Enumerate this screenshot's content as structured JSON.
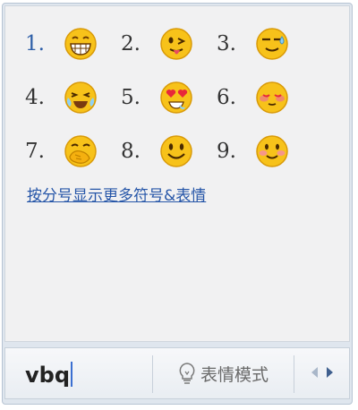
{
  "candidates": [
    {
      "num": "1.",
      "emoji": "grin",
      "selected": true
    },
    {
      "num": "2.",
      "emoji": "wink-tongue",
      "selected": false
    },
    {
      "num": "3.",
      "emoji": "sweat-smirk",
      "selected": false
    },
    {
      "num": "4.",
      "emoji": "crying-laugh",
      "selected": false
    },
    {
      "num": "5.",
      "emoji": "heart-eyes",
      "selected": false
    },
    {
      "num": "6.",
      "emoji": "blush-closed-eyes",
      "selected": false
    },
    {
      "num": "7.",
      "emoji": "hand-over-mouth",
      "selected": false
    },
    {
      "num": "8.",
      "emoji": "smile",
      "selected": false
    },
    {
      "num": "9.",
      "emoji": "blush-smile",
      "selected": false
    }
  ],
  "more_link": "按分号显示更多符号&表情",
  "composition": "vbq",
  "mode_button": "表情模式",
  "colors": {
    "face": "#f7c21a",
    "face_edge": "#d99a08",
    "link": "#2656a8",
    "selected_num": "#2e5fa8"
  }
}
